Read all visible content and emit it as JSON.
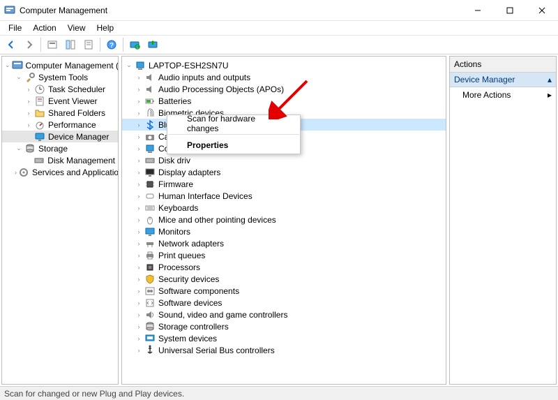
{
  "window": {
    "title": "Computer Management"
  },
  "menu": {
    "items": [
      "File",
      "Action",
      "View",
      "Help"
    ]
  },
  "left_tree": {
    "root": "Computer Management (Local)",
    "nodes": [
      {
        "label": "System Tools",
        "depth": 1,
        "exp": "open",
        "icon": "tools"
      },
      {
        "label": "Task Scheduler",
        "depth": 2,
        "exp": "closed",
        "icon": "clock"
      },
      {
        "label": "Event Viewer",
        "depth": 2,
        "exp": "closed",
        "icon": "log"
      },
      {
        "label": "Shared Folders",
        "depth": 2,
        "exp": "closed",
        "icon": "folder"
      },
      {
        "label": "Performance",
        "depth": 2,
        "exp": "closed",
        "icon": "gauge"
      },
      {
        "label": "Device Manager",
        "depth": 2,
        "exp": "leaf",
        "icon": "device",
        "selected": true
      },
      {
        "label": "Storage",
        "depth": 1,
        "exp": "open",
        "icon": "storage"
      },
      {
        "label": "Disk Management",
        "depth": 2,
        "exp": "leaf",
        "icon": "disk"
      },
      {
        "label": "Services and Applications",
        "depth": 1,
        "exp": "closed",
        "icon": "services"
      }
    ]
  },
  "device_tree": {
    "root": "LAPTOP-ESH2SN7U",
    "nodes": [
      {
        "label": "Audio inputs and outputs",
        "icon": "audio"
      },
      {
        "label": "Audio Processing Objects (APOs)",
        "icon": "audio"
      },
      {
        "label": "Batteries",
        "icon": "battery"
      },
      {
        "label": "Biometric devices",
        "icon": "finger"
      },
      {
        "label": "Bluetooth",
        "icon": "bluetooth",
        "selected": true
      },
      {
        "label": "Cameras",
        "icon": "camera"
      },
      {
        "label": "Comput",
        "icon": "pc"
      },
      {
        "label": "Disk driv",
        "icon": "disk"
      },
      {
        "label": "Display adapters",
        "icon": "display"
      },
      {
        "label": "Firmware",
        "icon": "chip"
      },
      {
        "label": "Human Interface Devices",
        "icon": "hid"
      },
      {
        "label": "Keyboards",
        "icon": "keyboard"
      },
      {
        "label": "Mice and other pointing devices",
        "icon": "mouse"
      },
      {
        "label": "Monitors",
        "icon": "monitor"
      },
      {
        "label": "Network adapters",
        "icon": "net"
      },
      {
        "label": "Print queues",
        "icon": "printer"
      },
      {
        "label": "Processors",
        "icon": "cpu"
      },
      {
        "label": "Security devices",
        "icon": "shield"
      },
      {
        "label": "Software components",
        "icon": "swcomp"
      },
      {
        "label": "Software devices",
        "icon": "swdev"
      },
      {
        "label": "Sound, video and game controllers",
        "icon": "sound"
      },
      {
        "label": "Storage controllers",
        "icon": "storage"
      },
      {
        "label": "System devices",
        "icon": "system"
      },
      {
        "label": "Universal Serial Bus controllers",
        "icon": "usb"
      }
    ]
  },
  "context_menu": {
    "items": [
      {
        "label": "Scan for hardware changes",
        "bold": false
      },
      {
        "label": "Properties",
        "bold": true
      }
    ]
  },
  "actions": {
    "header": "Actions",
    "subheader": "Device Manager",
    "items": [
      "More Actions"
    ]
  },
  "statusbar": {
    "text": "Scan for changed or new Plug and Play devices."
  }
}
